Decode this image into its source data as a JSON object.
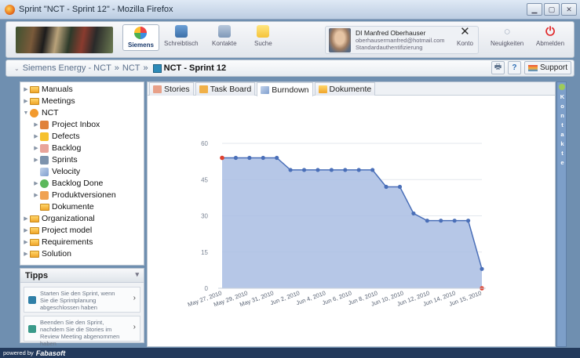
{
  "window": {
    "title": "Sprint \"NCT - Sprint 12\" - Mozilla Firefox"
  },
  "header": {
    "nav": [
      {
        "label": "Siemens",
        "icon": "siemens-logo-icon",
        "active": true
      },
      {
        "label": "Schreibtisch",
        "icon": "desk-icon"
      },
      {
        "label": "Kontakte",
        "icon": "contacts-icon"
      },
      {
        "label": "Suche",
        "icon": "search-icon"
      }
    ],
    "profile": {
      "name": "DI Manfred Oberhauser",
      "email": "oberhausermanfred@hotmail.com",
      "auth": "Standardauthentifizierung"
    },
    "actions": [
      {
        "label": "Konto",
        "icon": "tools-icon"
      },
      {
        "label": "Neuigkeiten",
        "icon": "news-icon"
      },
      {
        "label": "Abmelden",
        "icon": "power-icon"
      }
    ]
  },
  "breadcrumb": {
    "items": [
      "Siemens Energy - NCT",
      "NCT"
    ],
    "separator": "»",
    "current": "NCT - Sprint 12",
    "support_label": "Support"
  },
  "sidebar": {
    "items": [
      {
        "label": "Manuals"
      },
      {
        "label": "Meetings"
      },
      {
        "label": "NCT"
      },
      {
        "label": "Project Inbox"
      },
      {
        "label": "Defects"
      },
      {
        "label": "Backlog"
      },
      {
        "label": "Sprints"
      },
      {
        "label": "Velocity"
      },
      {
        "label": "Backlog Done"
      },
      {
        "label": "Produktversionen"
      },
      {
        "label": "Dokumente"
      },
      {
        "label": "Organizational"
      },
      {
        "label": "Project model"
      },
      {
        "label": "Requirements"
      },
      {
        "label": "Solution"
      }
    ]
  },
  "tipps": {
    "title": "Tipps",
    "items": [
      {
        "text": "Starten Sie den Sprint, wenn Sie die Sprintplanung abgeschlossen haben"
      },
      {
        "text": "Beenden Sie den Sprint, nachdem Sie die Stories im Review Meeting abgenommen haben"
      }
    ]
  },
  "tabs": [
    {
      "label": "Stories"
    },
    {
      "label": "Task Board"
    },
    {
      "label": "Burndown",
      "active": true
    },
    {
      "label": "Dokumente"
    }
  ],
  "side_panel": {
    "letters": [
      "K",
      "o",
      "n",
      "t",
      "a",
      "k",
      "t",
      "e"
    ]
  },
  "footer": {
    "powered_by": "powered by",
    "brand": "Fabasoft"
  },
  "colors": {
    "accent": "#2f6fb5",
    "area_fill": "#a9bde3",
    "line": "#4a6fb8",
    "marker_end": "#e0412e"
  },
  "chart_data": {
    "type": "area",
    "title": "",
    "xlabel": "",
    "ylabel": "",
    "ylim": [
      0,
      60
    ],
    "yticks": [
      0,
      15,
      30,
      45,
      60
    ],
    "xtick_labels": [
      "May 27, 2010",
      "May 29, 2010",
      "May 31, 2010",
      "Jun 2, 2010",
      "Jun 4, 2010",
      "Jun 6, 2010",
      "Jun 8, 2010",
      "Jun 10, 2010",
      "Jun 12, 2010",
      "Jun 14, 2010",
      "Jun 15, 2010"
    ],
    "x": [
      "2010-05-27",
      "2010-05-28",
      "2010-05-29",
      "2010-05-30",
      "2010-05-31",
      "2010-06-01",
      "2010-06-02",
      "2010-06-03",
      "2010-06-04",
      "2010-06-05",
      "2010-06-06",
      "2010-06-07",
      "2010-06-08",
      "2010-06-09",
      "2010-06-10",
      "2010-06-11",
      "2010-06-12",
      "2010-06-13",
      "2010-06-14",
      "2010-06-15"
    ],
    "series": [
      {
        "values": [
          54,
          54,
          54,
          54,
          54,
          49,
          49,
          49,
          49,
          49,
          49,
          49,
          42,
          42,
          31,
          28,
          28,
          28,
          28,
          8
        ]
      },
      {
        "values": [
          54,
          0
        ]
      }
    ],
    "grid": true,
    "legend": "none"
  }
}
